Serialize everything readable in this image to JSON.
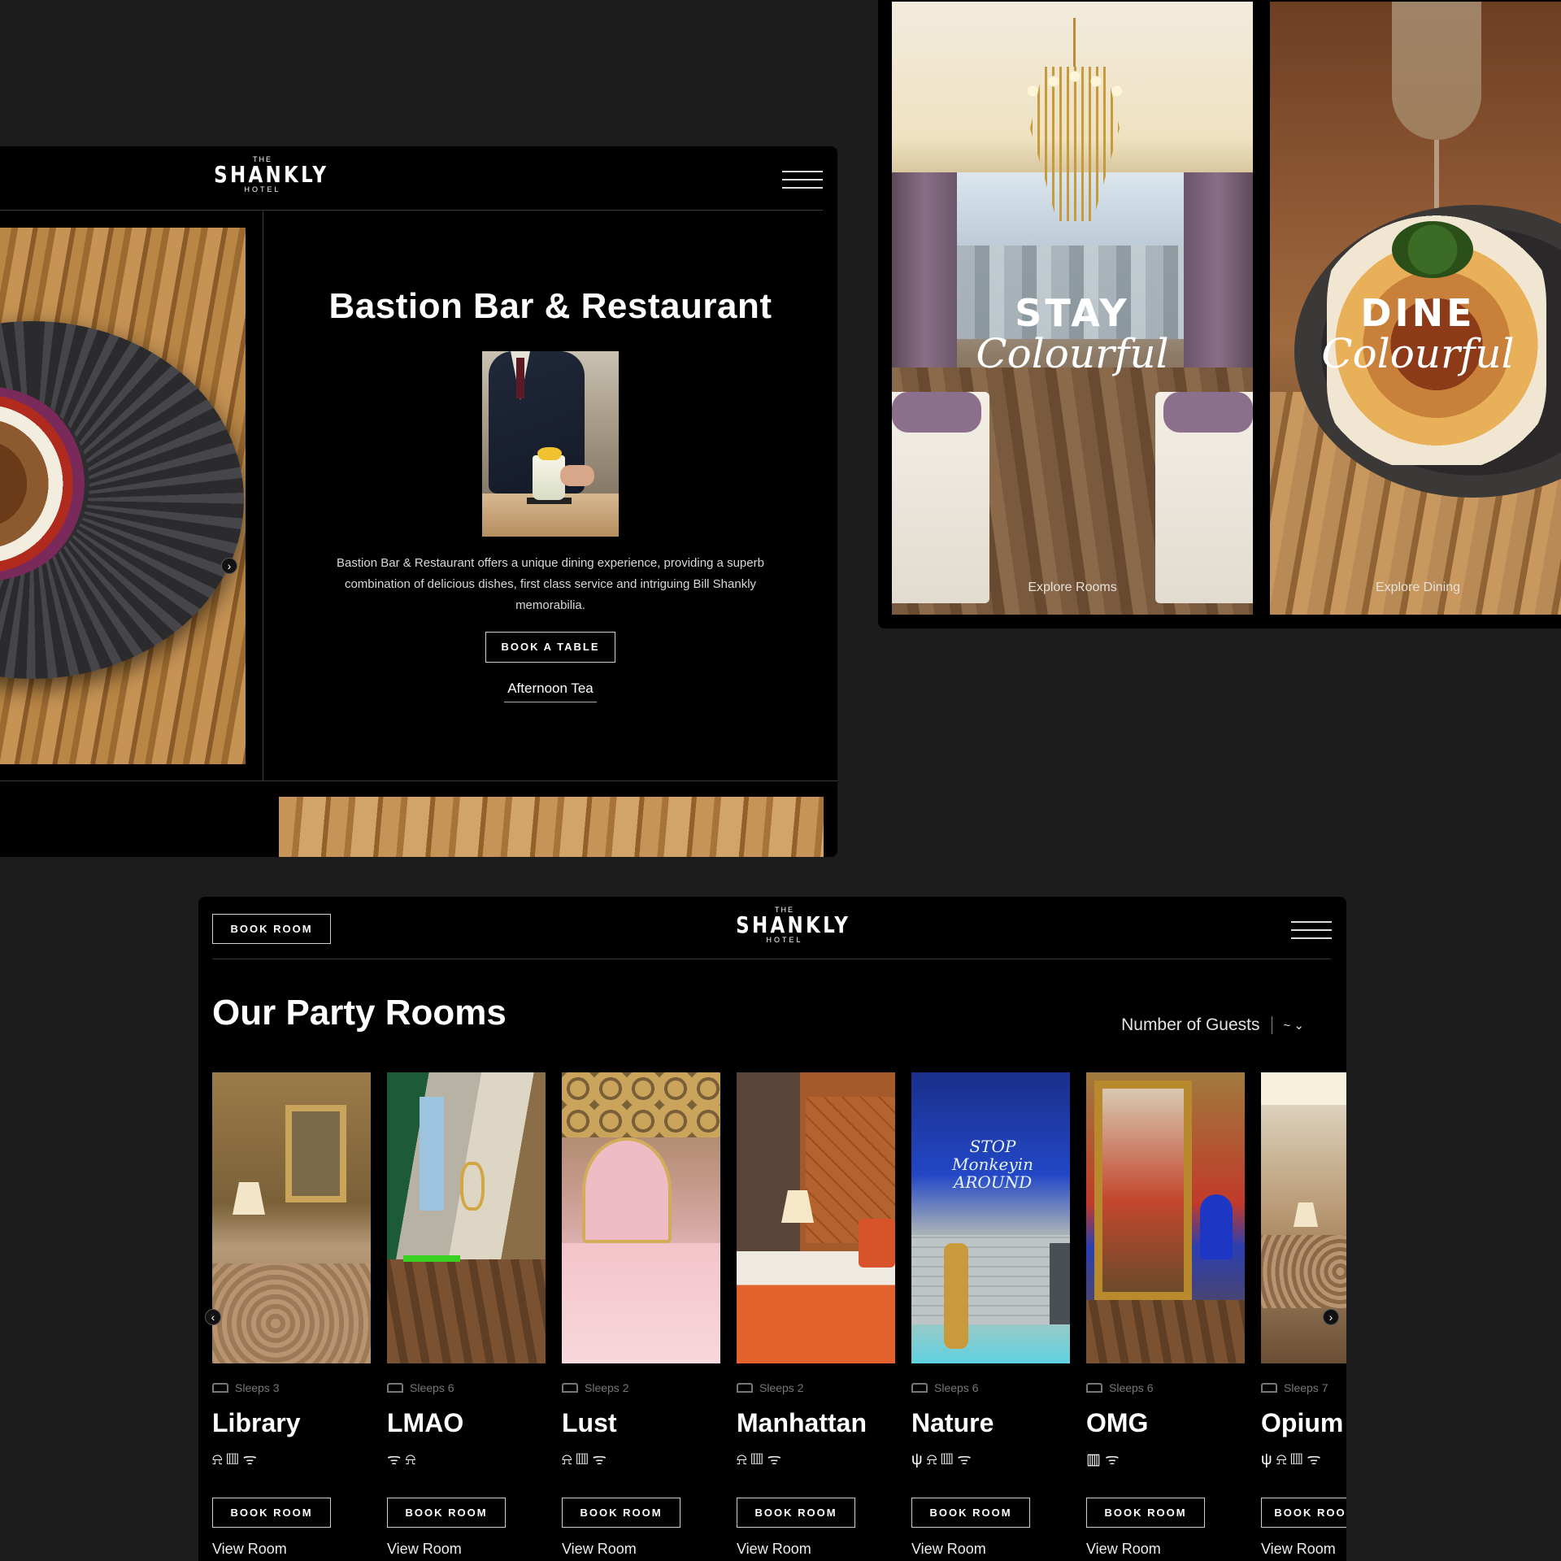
{
  "brand": {
    "the": "THE",
    "name": "SHANKLY",
    "hotel": "HOTEL"
  },
  "bastion": {
    "title": "Bastion Bar & Restaurant",
    "description": "Bastion Bar & Restaurant offers a unique dining experience, providing a superb combination of delicious dishes, first class service and intriguing Bill Shankly memorabilia.",
    "book_label": "BOOK A TABLE",
    "secondary_link": "Afternoon Tea",
    "next_arrow": "›"
  },
  "promo": [
    {
      "word": "STAY",
      "script": "Colourful",
      "link": "Explore Rooms"
    },
    {
      "word": "DINE",
      "script": "Colourful",
      "link": "Explore Dining"
    }
  ],
  "party": {
    "book_room_label": "BOOK ROOM",
    "title": "Our Party Rooms",
    "guests_label": "Number of Guests",
    "guests_dropdown": "~ ⌄",
    "prev_arrow": "‹",
    "next_arrow": "›",
    "rooms": [
      {
        "name": "Library",
        "sleeps": "Sleeps 3",
        "amenities": "⍾ ▥ ᯤ",
        "book": "BOOK ROOM",
        "view": "View Room"
      },
      {
        "name": "LMAO",
        "sleeps": "Sleeps 6",
        "amenities": "ᯤ ⍾",
        "book": "BOOK ROOM",
        "view": "View Room"
      },
      {
        "name": "Lust",
        "sleeps": "Sleeps 2",
        "amenities": "⍾ ▥ ᯤ",
        "book": "BOOK ROOM",
        "view": "View Room"
      },
      {
        "name": "Manhattan",
        "sleeps": "Sleeps 2",
        "amenities": "⍾ ▥ ᯤ",
        "book": "BOOK ROOM",
        "view": "View Room"
      },
      {
        "name": "Nature",
        "sleeps": "Sleeps 6",
        "amenities": "ψ ⍾ ▥ ᯤ",
        "book": "BOOK ROOM",
        "view": "View Room"
      },
      {
        "name": "OMG",
        "sleeps": "Sleeps 6",
        "amenities": "▥ ᯤ",
        "book": "BOOK ROOM",
        "view": "View Room"
      },
      {
        "name": "Opium",
        "sleeps": "Sleeps 7",
        "amenities": "ψ ⍾ ▥ ᯤ",
        "book": "BOOK ROO",
        "view": "View Room"
      }
    ],
    "neon_sign": "STOP Monkeyin AROUND"
  }
}
